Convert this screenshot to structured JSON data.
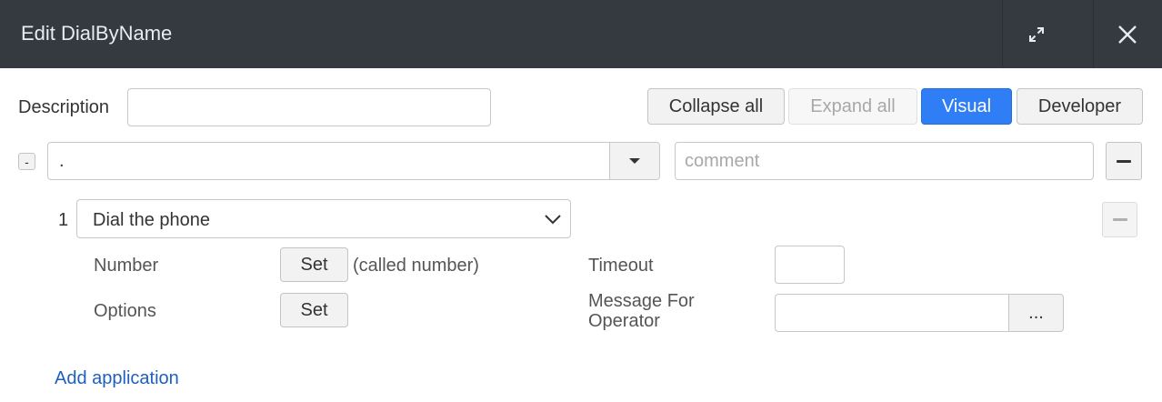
{
  "dialog": {
    "title": "Edit DialByName",
    "expand_icon": "expand-arrows-icon",
    "close_icon": "close-icon"
  },
  "toolbar": {
    "description_label": "Description",
    "description_value": "",
    "collapse_all": "Collapse all",
    "expand_all": "Expand all",
    "visual": "Visual",
    "developer": "Developer"
  },
  "context": {
    "toggle": "-",
    "value": ".",
    "comment_placeholder": "comment"
  },
  "step": {
    "number": "1",
    "application": "Dial the phone",
    "params": {
      "number_label": "Number",
      "number_button": "Set",
      "number_hint": "(called number)",
      "options_label": "Options",
      "options_button": "Set",
      "timeout_label": "Timeout",
      "timeout_value": "",
      "message_label_line1": "Message For",
      "message_label_line2": "Operator",
      "message_value": "",
      "message_more": "..."
    }
  },
  "add_application": "Add application",
  "colors": {
    "titlebar": "#343a40",
    "primary": "#2f7ef5",
    "link": "#1f5fbf"
  }
}
